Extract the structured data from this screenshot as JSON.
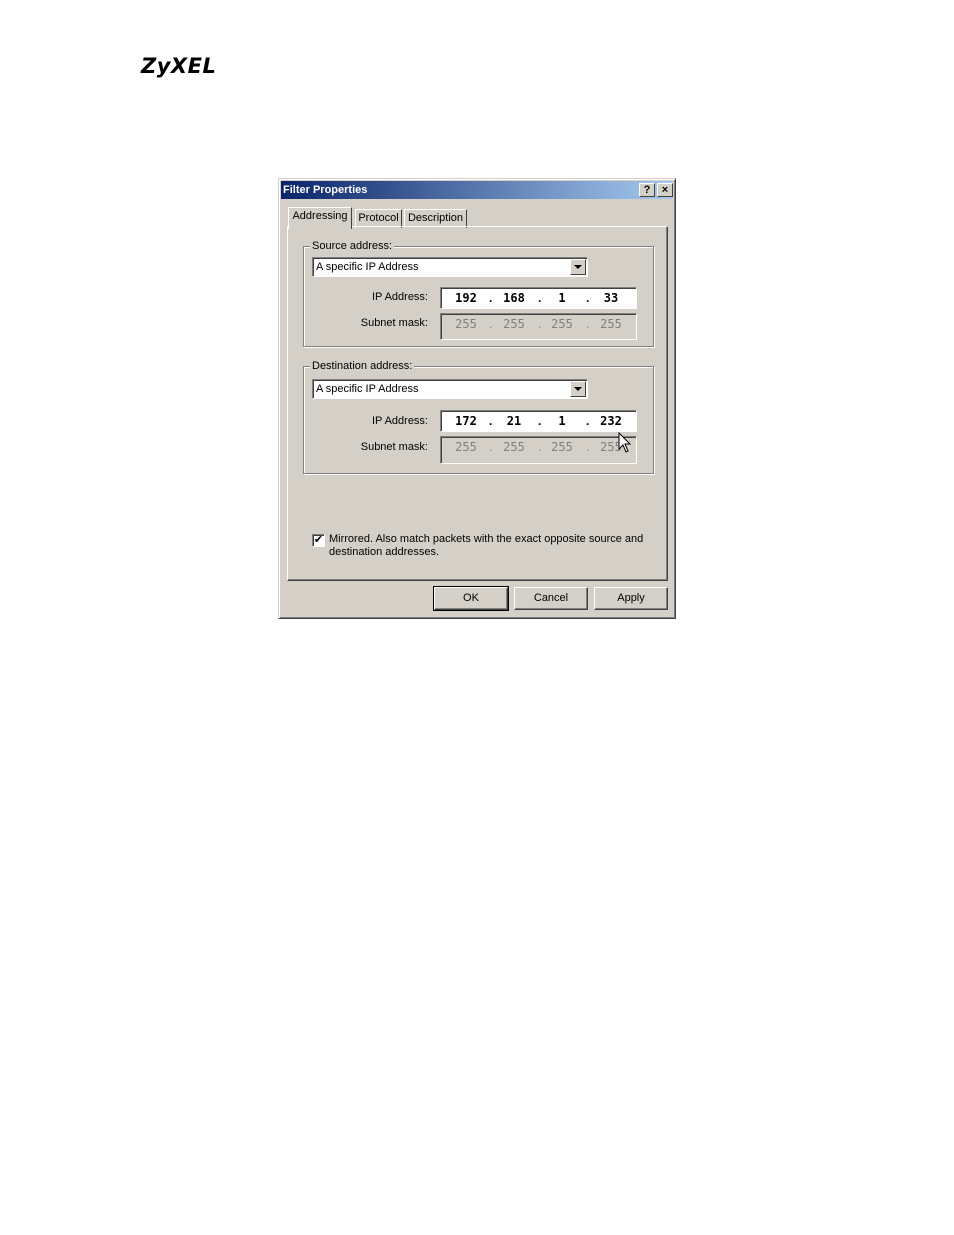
{
  "brand": {
    "logo_text": "ZyXEL"
  },
  "dialog": {
    "title": "Filter Properties",
    "help_button": "?",
    "close_button": "×",
    "tabs": [
      {
        "label": "Addressing",
        "active": true
      },
      {
        "label": "Protocol",
        "active": false
      },
      {
        "label": "Description",
        "active": false
      }
    ],
    "source": {
      "group_label": "Source address:",
      "type_selected": "A specific IP Address",
      "ip_label": "IP Address:",
      "ip": [
        "192",
        "168",
        "1",
        "33"
      ],
      "mask_label": "Subnet mask:",
      "mask": [
        "255",
        "255",
        "255",
        "255"
      ]
    },
    "destination": {
      "group_label": "Destination address:",
      "type_selected": "A specific IP Address",
      "ip_label": "IP Address:",
      "ip": [
        "172",
        "21",
        "1",
        "232"
      ],
      "mask_label": "Subnet mask:",
      "mask": [
        "255",
        "255",
        "255",
        "255"
      ]
    },
    "mirrored": {
      "checked": true,
      "check_glyph": "✔",
      "label": "Mirrored. Also match packets with the exact opposite source and destination addresses."
    },
    "buttons": {
      "ok": "OK",
      "cancel": "Cancel",
      "apply": "Apply"
    }
  }
}
